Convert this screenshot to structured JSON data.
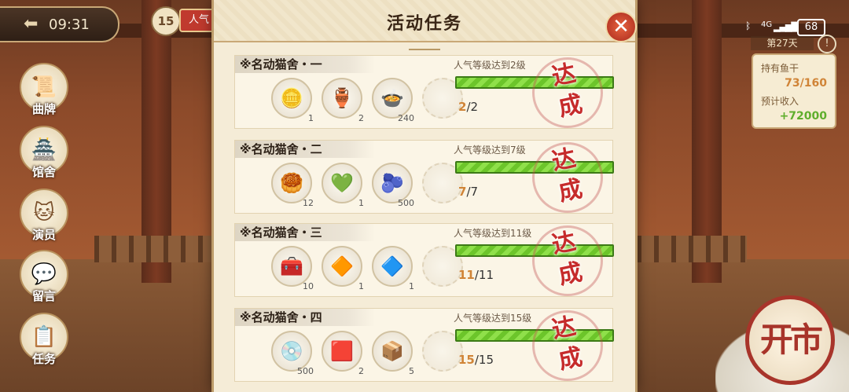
{
  "clock": "09:31",
  "player_level": "15",
  "popularity_tag": "人气",
  "status": {
    "net": "4G",
    "signal": "▂▄▆█",
    "battery": "68"
  },
  "day_label": "第27天",
  "resources": {
    "dried_fish_label": "持有鱼干",
    "dried_fish_value": "73/160",
    "income_label": "预计收入",
    "income_value": "+72000"
  },
  "left_menu": [
    {
      "label": "曲牌",
      "icon": "scroll-icon",
      "glyph": "📜"
    },
    {
      "label": "馆舍",
      "icon": "building-icon",
      "glyph": "🏯"
    },
    {
      "label": "演员",
      "icon": "cat-icon",
      "glyph": "🐱"
    },
    {
      "label": "留言",
      "icon": "chat-icon",
      "glyph": "💬"
    },
    {
      "label": "任务",
      "icon": "task-icon",
      "glyph": "📋"
    }
  ],
  "open_button": "开市",
  "dialog": {
    "title": "活动任务",
    "close_icon": "close-icon",
    "tasks": [
      {
        "title": "※名动猫舍・一",
        "condition": "人气等级达到2级",
        "progress_current": "2",
        "progress_total": "/2",
        "progress_fraction": 1.0,
        "status": "达成",
        "rewards": [
          {
            "icon": "silver-ingot-icon",
            "glyph": "🪙",
            "qty": "1"
          },
          {
            "icon": "blue-vase-icon",
            "glyph": "🏺",
            "qty": "2"
          },
          {
            "icon": "food-bowl-icon",
            "glyph": "🍲",
            "qty": "240"
          }
        ]
      },
      {
        "title": "※名动猫舍・二",
        "condition": "人气等级达到7级",
        "progress_current": "7",
        "progress_total": "/7",
        "progress_fraction": 1.0,
        "status": "达成",
        "rewards": [
          {
            "icon": "gold-nugget-icon",
            "glyph": "🥮",
            "qty": "12"
          },
          {
            "icon": "green-gem-icon",
            "glyph": "💚",
            "qty": "1"
          },
          {
            "icon": "blue-fruit-icon",
            "glyph": "🫐",
            "qty": "500"
          }
        ]
      },
      {
        "title": "※名动猫舍・三",
        "condition": "人气等级达到11级",
        "progress_current": "11",
        "progress_total": "/11",
        "progress_fraction": 1.0,
        "status": "达成",
        "rewards": [
          {
            "icon": "gem-chest-icon",
            "glyph": "🧰",
            "qty": "10"
          },
          {
            "icon": "orange-rune-icon",
            "glyph": "🔶",
            "qty": "1"
          },
          {
            "icon": "blue-rune-icon",
            "glyph": "🔷",
            "qty": "1"
          }
        ]
      },
      {
        "title": "※名动猫舍・四",
        "condition": "人气等级达到15级",
        "progress_current": "15",
        "progress_total": "/15",
        "progress_fraction": 1.0,
        "status": "达成",
        "rewards": [
          {
            "icon": "silver-coin-icon",
            "glyph": "💿",
            "qty": "500"
          },
          {
            "icon": "red-gem-icon",
            "glyph": "🟥",
            "qty": "2"
          },
          {
            "icon": "treasure-chest-icon",
            "glyph": "📦",
            "qty": "5"
          }
        ]
      }
    ]
  }
}
